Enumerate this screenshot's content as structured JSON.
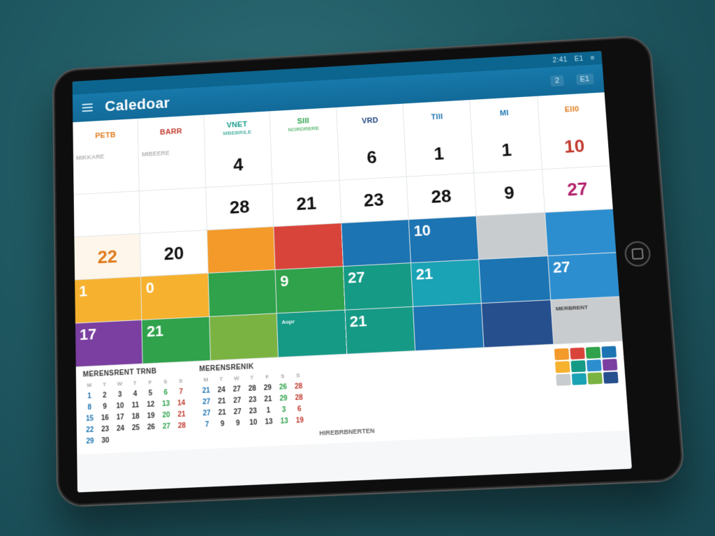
{
  "status": {
    "left": "2:41",
    "mid": "E1",
    "right": "≡"
  },
  "header": {
    "title": "Caledoar",
    "chips": [
      "2",
      "E1"
    ],
    "menu_icon": "menu-icon",
    "cal_icon": "calendar-icon"
  },
  "day_headers": [
    {
      "top": "PETB",
      "sub": "",
      "cls": "c-orange"
    },
    {
      "top": "BARR",
      "sub": "",
      "cls": "c-red"
    },
    {
      "top": "VNET",
      "sub": "MBEBRILE",
      "cls": "c-teal"
    },
    {
      "top": "SIII",
      "sub": "NORDRERE",
      "cls": "c-green"
    },
    {
      "top": "VRD",
      "sub": "",
      "cls": "c-navy"
    },
    {
      "top": "TIII",
      "sub": "",
      "cls": "c-blue"
    },
    {
      "top": "MI",
      "sub": "",
      "cls": "c-blue"
    },
    {
      "top": "EII0",
      "sub": "",
      "cls": "c-orange"
    }
  ],
  "rows": [
    [
      {
        "v": "",
        "lbl": "MIKKARE",
        "cls": "dim sm"
      },
      {
        "v": "",
        "lbl": "MIBEERE",
        "cls": "dim sm"
      },
      {
        "v": "4",
        "cls": ""
      },
      {
        "v": "",
        "cls": ""
      },
      {
        "v": "6",
        "cls": ""
      },
      {
        "v": "1",
        "cls": ""
      },
      {
        "v": "1",
        "cls": ""
      },
      {
        "v": "10",
        "cls": "red"
      }
    ],
    [
      {
        "v": "",
        "cls": ""
      },
      {
        "v": "",
        "cls": ""
      },
      {
        "v": "28",
        "cls": ""
      },
      {
        "v": "21",
        "cls": ""
      },
      {
        "v": "23",
        "cls": ""
      },
      {
        "v": "28",
        "cls": ""
      },
      {
        "v": "9",
        "cls": ""
      },
      {
        "v": "27",
        "cls": "mag"
      }
    ],
    [
      {
        "v": "22",
        "cls": "accent today"
      },
      {
        "v": "20",
        "cls": ""
      },
      {
        "v": "",
        "tile": "bg-orange",
        "tiny": ""
      },
      {
        "v": "",
        "tile": "bg-red",
        "tiny": ""
      },
      {
        "v": "",
        "tile": "bg-blue",
        "tiny": ""
      },
      {
        "v": "10",
        "tile": "bg-blue",
        "tiny": ""
      },
      {
        "v": "",
        "tile": "bg-gray",
        "tiny": ""
      },
      {
        "v": "",
        "tile": "bg-blue2",
        "tiny": ""
      }
    ],
    [
      {
        "v": "1",
        "tile": "bg-amber",
        "tiny": ""
      },
      {
        "v": "0",
        "tile": "bg-amber",
        "tiny": ""
      },
      {
        "v": "",
        "tile": "bg-green",
        "tiny": ""
      },
      {
        "v": "9",
        "tile": "bg-green",
        "tiny": ""
      },
      {
        "v": "27",
        "tile": "bg-teal",
        "tiny": ""
      },
      {
        "v": "21",
        "tile": "bg-cyan",
        "tiny": ""
      },
      {
        "v": "",
        "tile": "bg-blue",
        "tiny": ""
      },
      {
        "v": "27",
        "tile": "bg-blue2",
        "tiny": ""
      }
    ],
    [
      {
        "v": "17",
        "tile": "bg-purple",
        "tiny": ""
      },
      {
        "v": "21",
        "tile": "bg-green",
        "tiny": ""
      },
      {
        "v": "",
        "tile": "bg-lime",
        "tiny": ""
      },
      {
        "v": "",
        "tile": "bg-teal",
        "tiny": "Aopr"
      },
      {
        "v": "21",
        "tile": "bg-teal",
        "tiny": ""
      },
      {
        "v": "",
        "tile": "bg-blue",
        "tiny": ""
      },
      {
        "v": "",
        "tile": "bg-navy",
        "tiny": ""
      },
      {
        "v": "",
        "tile": "bg-gray",
        "tiny": "MERBRENT"
      }
    ]
  ],
  "mini": {
    "title1": "MERENSRENT TRNB",
    "title2": "MERENSRENIK",
    "head": [
      "M",
      "T",
      "W",
      "T",
      "F",
      "S",
      "S"
    ],
    "m1": [
      "1",
      "2",
      "3",
      "4",
      "5",
      "6",
      "7",
      "8",
      "9",
      "10",
      "11",
      "12",
      "13",
      "14",
      "15",
      "16",
      "17",
      "18",
      "19",
      "20",
      "21",
      "22",
      "23",
      "24",
      "25",
      "26",
      "27",
      "28",
      "29",
      "30"
    ],
    "m2": [
      "21",
      "24",
      "27",
      "28",
      "29",
      "26",
      "28",
      "27",
      "21",
      "27",
      "23",
      "21",
      "29",
      "28",
      "27",
      "21",
      "27",
      "23",
      "1",
      "3",
      "6",
      "7",
      "9",
      "9",
      "10",
      "13",
      "13",
      "19"
    ],
    "swatch": [
      "#f39a2b",
      "#d9443a",
      "#2fa24b",
      "#1c74b2",
      "#f6b12e",
      "#159a86",
      "#2d8ecf",
      "#7a3fa0",
      "#c9ccce",
      "#1aa2b5",
      "#7bb342",
      "#264f8e"
    ],
    "legend": "HIREBRBNERTEN"
  }
}
